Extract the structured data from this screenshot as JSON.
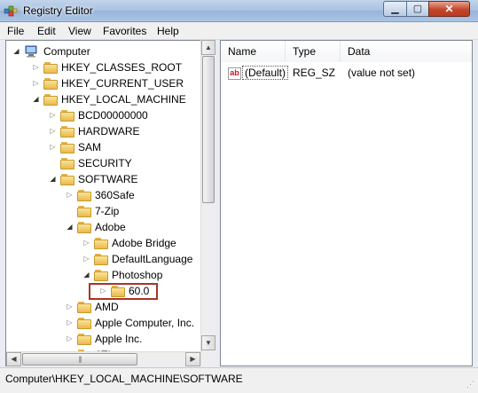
{
  "window": {
    "title": "Registry Editor"
  },
  "titlebar_buttons": {
    "minimize": "▁",
    "maximize": "▢",
    "close": "✕"
  },
  "menu": [
    "File",
    "Edit",
    "View",
    "Favorites",
    "Help"
  ],
  "tree": {
    "root": "Computer",
    "nodes": [
      {
        "label": "HKEY_CLASSES_ROOT",
        "depth": 1,
        "expander": "collapsed"
      },
      {
        "label": "HKEY_CURRENT_USER",
        "depth": 1,
        "expander": "collapsed"
      },
      {
        "label": "HKEY_LOCAL_MACHINE",
        "depth": 1,
        "expander": "expanded"
      },
      {
        "label": "BCD00000000",
        "depth": 2,
        "expander": "collapsed"
      },
      {
        "label": "HARDWARE",
        "depth": 2,
        "expander": "collapsed"
      },
      {
        "label": "SAM",
        "depth": 2,
        "expander": "collapsed"
      },
      {
        "label": "SECURITY",
        "depth": 2,
        "expander": "none"
      },
      {
        "label": "SOFTWARE",
        "depth": 2,
        "expander": "expanded",
        "selected": true
      },
      {
        "label": "360Safe",
        "depth": 3,
        "expander": "collapsed"
      },
      {
        "label": "7-Zip",
        "depth": 3,
        "expander": "none"
      },
      {
        "label": "Adobe",
        "depth": 3,
        "expander": "expanded"
      },
      {
        "label": "Adobe Bridge",
        "depth": 4,
        "expander": "collapsed"
      },
      {
        "label": "DefaultLanguage",
        "depth": 4,
        "expander": "collapsed"
      },
      {
        "label": "Photoshop",
        "depth": 4,
        "expander": "expanded"
      },
      {
        "label": "60.0",
        "depth": 5,
        "expander": "collapsed",
        "highlighted": true
      },
      {
        "label": "AMD",
        "depth": 3,
        "expander": "collapsed"
      },
      {
        "label": "Apple Computer, Inc.",
        "depth": 3,
        "expander": "collapsed"
      },
      {
        "label": "Apple Inc.",
        "depth": 3,
        "expander": "collapsed"
      },
      {
        "label": "ATI",
        "depth": 3,
        "expander": "collapsed"
      }
    ]
  },
  "list": {
    "columns": [
      "Name",
      "Type",
      "Data"
    ],
    "rows": [
      {
        "icon": "ab",
        "name": "(Default)",
        "type": "REG_SZ",
        "data": "(value not set)"
      }
    ]
  },
  "status": {
    "path": "Computer\\HKEY_LOCAL_MACHINE\\SOFTWARE"
  },
  "colors": {
    "highlight_border": "#a93426",
    "folder": "#f2cd6b",
    "close_button": "#c4462a"
  }
}
